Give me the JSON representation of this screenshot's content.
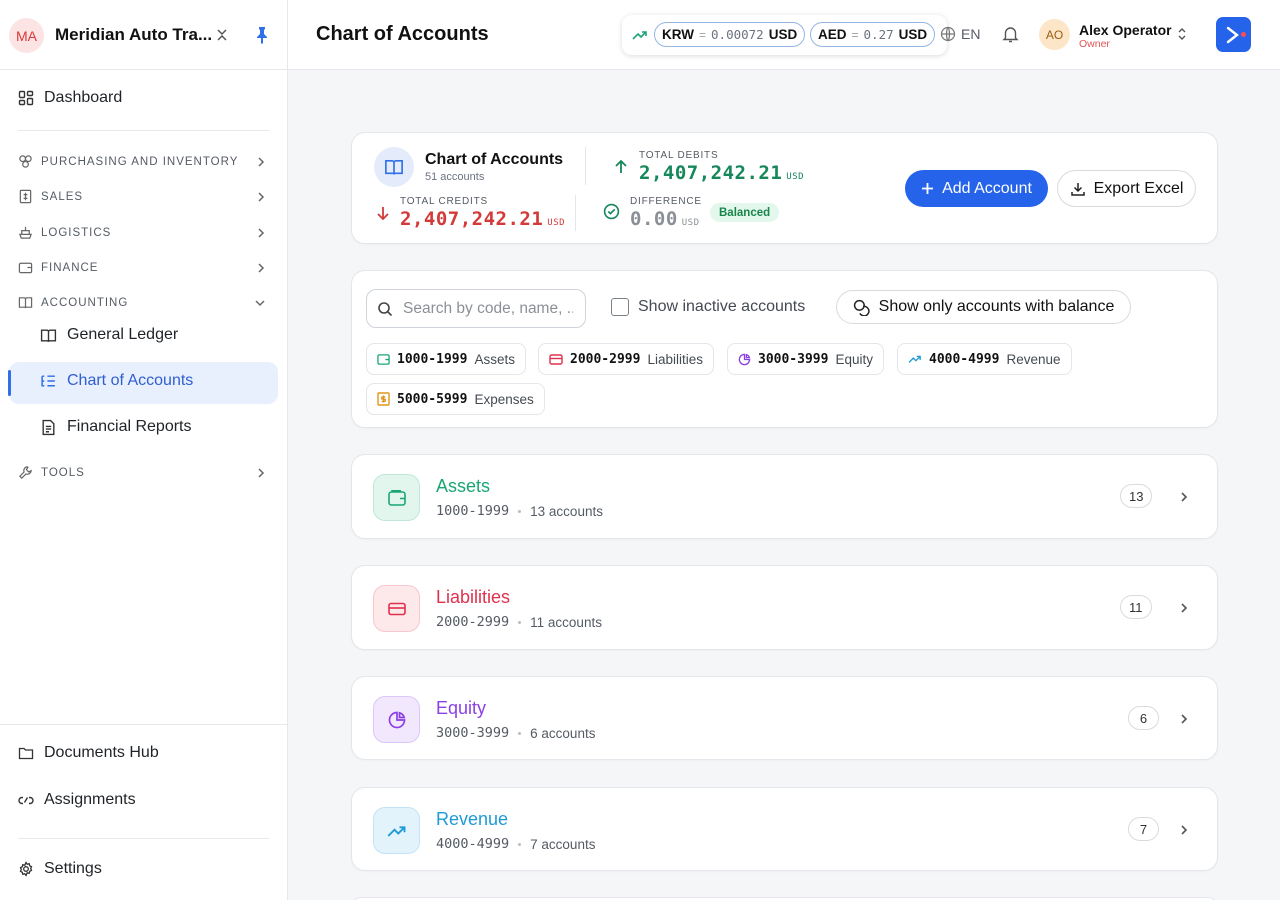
{
  "org": {
    "initials": "MA",
    "name": "Meridian Auto Tra..."
  },
  "sidebar": {
    "dashboard": "Dashboard",
    "sections": [
      {
        "label": "PURCHASING AND INVENTORY"
      },
      {
        "label": "SALES"
      },
      {
        "label": "LOGISTICS"
      },
      {
        "label": "FINANCE"
      },
      {
        "label": "ACCOUNTING"
      },
      {
        "label": "TOOLS"
      }
    ],
    "accounting_items": [
      "General Ledger",
      "Chart of Accounts",
      "Financial Reports"
    ],
    "active_item": "Chart of Accounts",
    "footer": [
      "Documents Hub",
      "Assignments",
      "Settings"
    ]
  },
  "header": {
    "title": "Chart of Accounts",
    "fx": [
      {
        "currency": "KRW",
        "sep": "=",
        "rate": "0.00072",
        "base": "USD"
      },
      {
        "currency": "AED",
        "sep": "=",
        "rate": "0.27",
        "base": "USD"
      }
    ],
    "language": "EN",
    "user": {
      "initials": "AO",
      "name": "Alex Operator",
      "role": "Owner"
    }
  },
  "summary": {
    "title": "Chart of Accounts",
    "subtitle": "51 accounts",
    "total_debits_label": "TOTAL DEBITS",
    "total_debits": "2,407,242.21",
    "total_credits_label": "TOTAL CREDITS",
    "total_credits": "2,407,242.21",
    "difference_label": "DIFFERENCE",
    "difference": "0.00",
    "unit": "USD",
    "status": "Balanced",
    "add_button": "Add Account",
    "export_button": "Export Excel"
  },
  "filters": {
    "search_placeholder": "Search by code, name, ...",
    "show_inactive": "Show inactive accounts",
    "only_balance": "Show only accounts with balance",
    "ranges": [
      {
        "range": "1000-1999",
        "label": "Assets",
        "color": "#1aa672"
      },
      {
        "range": "2000-2999",
        "label": "Liabilities",
        "color": "#e1304d"
      },
      {
        "range": "3000-3999",
        "label": "Equity",
        "color": "#8b3fe6"
      },
      {
        "range": "4000-4999",
        "label": "Revenue",
        "color": "#1e9ad6"
      },
      {
        "range": "5000-5999",
        "label": "Expenses",
        "color": "#e0961a"
      }
    ]
  },
  "categories": [
    {
      "name": "Assets",
      "range": "1000-1999",
      "accounts": "13 accounts",
      "count": "13",
      "color": "#1aa672",
      "bg": "#e6f6ef",
      "icon": "wallet-icon"
    },
    {
      "name": "Liabilities",
      "range": "2000-2999",
      "accounts": "11 accounts",
      "count": "11",
      "color": "#e1304d",
      "bg": "#fde8ea",
      "icon": "credit-card-icon"
    },
    {
      "name": "Equity",
      "range": "3000-3999",
      "accounts": "6 accounts",
      "count": "6",
      "color": "#8b3fe6",
      "bg": "#f1e8fd",
      "icon": "pie-chart-icon"
    },
    {
      "name": "Revenue",
      "range": "4000-4999",
      "accounts": "7 accounts",
      "count": "7",
      "color": "#1e9ad6",
      "bg": "#e3f3fc",
      "icon": "trending-up-icon"
    }
  ]
}
